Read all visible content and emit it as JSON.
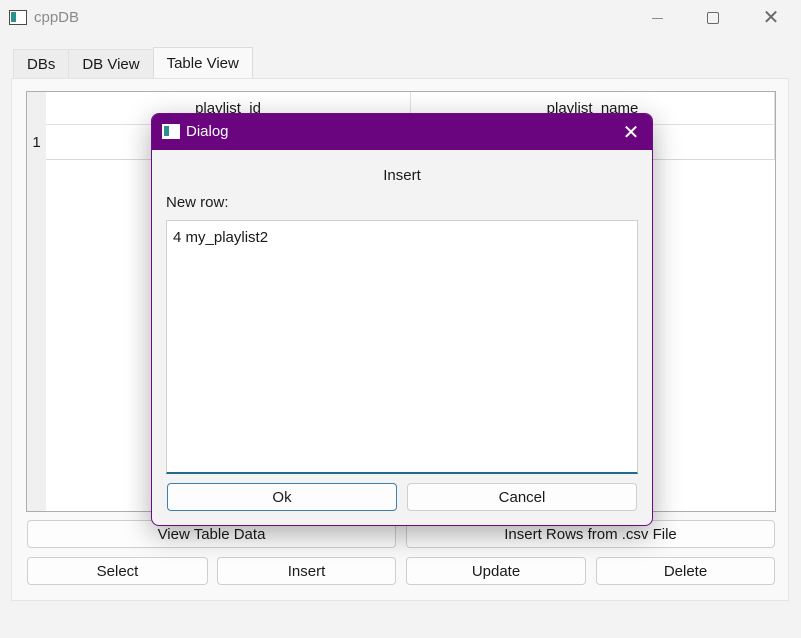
{
  "window": {
    "title": "cppDB"
  },
  "tabs": [
    {
      "label": "DBs"
    },
    {
      "label": "DB View"
    },
    {
      "label": "Table View"
    }
  ],
  "table": {
    "columns": [
      "playlist_id",
      "playlist_name"
    ],
    "row_numbers": [
      "1"
    ]
  },
  "buttons": {
    "view_table": "View Table Data",
    "insert_csv": "Insert Rows from .csv File",
    "select": "Select",
    "insert": "Insert",
    "update": "Update",
    "delete": "Delete"
  },
  "dialog": {
    "title": "Dialog",
    "heading": "Insert",
    "label": "New row:",
    "text_value": "4 my_playlist2",
    "ok": "Ok",
    "cancel": "Cancel"
  },
  "colors": {
    "dialog_titlebar": "#6a047f",
    "focus_accent": "#1f6b8c"
  }
}
